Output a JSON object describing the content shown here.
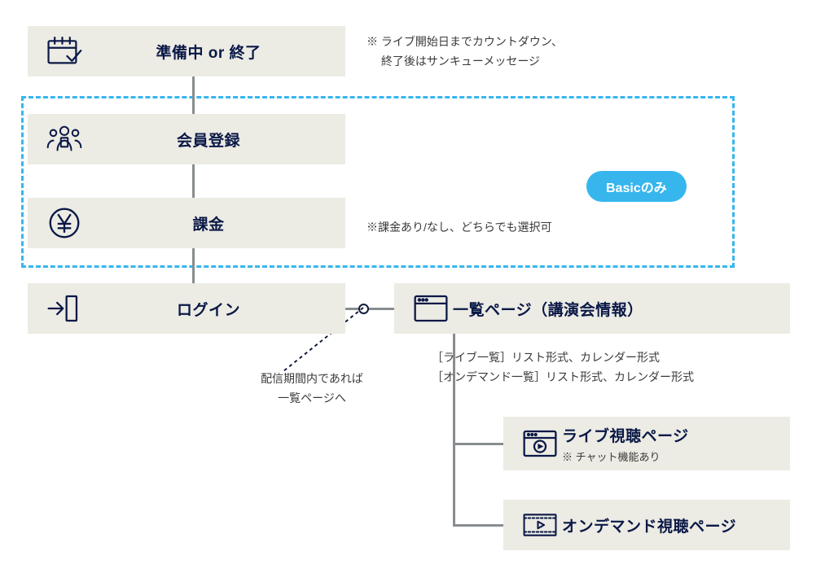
{
  "nodes": {
    "preparing": {
      "title": "準備中 or 終了"
    },
    "register": {
      "title": "会員登録"
    },
    "billing": {
      "title": "課金"
    },
    "login": {
      "title": "ログイン"
    },
    "list": {
      "title": "一覧ページ（講演会情報）"
    },
    "live": {
      "title": "ライブ視聴ページ",
      "sub": "※ チャット機能あり"
    },
    "ondemand": {
      "title": "オンデマンド視聴ページ"
    }
  },
  "notes": {
    "preparing_note_line1": "※ ライブ開始日までカウントダウン、",
    "preparing_note_line2": "　 終了後はサンキューメッセージ",
    "billing_note": "※課金あり/なし、どちらでも選択可",
    "login_note_line1": "配信期間内であれば",
    "login_note_line2": "一覧ページへ",
    "list_detail_line1": "［ライブ一覧］リスト形式、カレンダー形式",
    "list_detail_line2": "［オンデマンド一覧］リスト形式、カレンダー形式"
  },
  "badge": "Basicのみ",
  "colors": {
    "navy": "#0a1846",
    "card": "#ecebe4",
    "accent": "#37b6ee",
    "connector": "#888d8f"
  }
}
